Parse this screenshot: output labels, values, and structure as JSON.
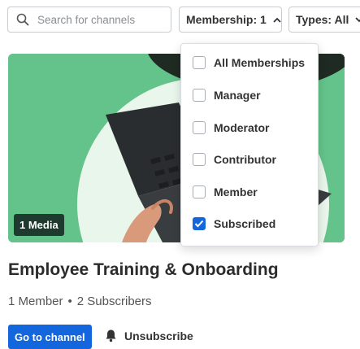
{
  "search": {
    "placeholder": "Search for channels"
  },
  "filters": {
    "membership_label": "Membership: 1",
    "types_label": "Types: All"
  },
  "dropdown": {
    "options": [
      {
        "label": "All Memberships",
        "checked": false
      },
      {
        "label": "Manager",
        "checked": false
      },
      {
        "label": "Moderator",
        "checked": false
      },
      {
        "label": "Contributor",
        "checked": false
      },
      {
        "label": "Member",
        "checked": false
      },
      {
        "label": "Subscribed",
        "checked": true
      }
    ]
  },
  "card": {
    "media_badge": "1 Media",
    "title": "Employee Training & Onboarding",
    "members": "1 Member",
    "separator": "•",
    "subscribers": "2 Subscribers",
    "go_label": "Go to channel",
    "unsubscribe_label": "Unsubscribe"
  },
  "colors": {
    "accent": "#1466dc",
    "card_green": "#63c38a",
    "badge_bg": "#1f3b2f"
  }
}
